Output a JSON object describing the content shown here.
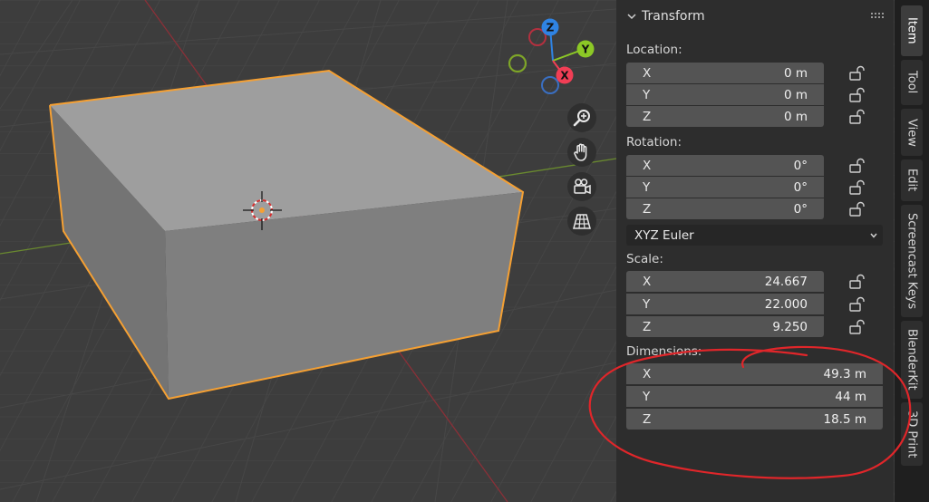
{
  "gizmo": {
    "z_label": "Z",
    "y_label": "Y",
    "x_label": "X",
    "colors": {
      "z": "#2f83e3",
      "y": "#8cc826",
      "x": "#f13e55"
    }
  },
  "nav_icons": [
    "zoom-icon",
    "hand-pan-icon",
    "camera-icon",
    "grid-perspective-icon"
  ],
  "panel": {
    "title": "Transform",
    "location": {
      "label": "Location:",
      "rows": [
        {
          "axis": "X",
          "value": "0 m"
        },
        {
          "axis": "Y",
          "value": "0 m"
        },
        {
          "axis": "Z",
          "value": "0 m"
        }
      ]
    },
    "rotation": {
      "label": "Rotation:",
      "rows": [
        {
          "axis": "X",
          "value": "0°"
        },
        {
          "axis": "Y",
          "value": "0°"
        },
        {
          "axis": "Z",
          "value": "0°"
        }
      ],
      "mode": "XYZ Euler"
    },
    "scale": {
      "label": "Scale:",
      "rows": [
        {
          "axis": "X",
          "value": "24.667"
        },
        {
          "axis": "Y",
          "value": "22.000"
        },
        {
          "axis": "Z",
          "value": "9.250"
        }
      ]
    },
    "dimensions": {
      "label": "Dimensions:",
      "rows": [
        {
          "axis": "X",
          "value": "49.3 m"
        },
        {
          "axis": "Y",
          "value": "44 m"
        },
        {
          "axis": "Z",
          "value": "18.5 m"
        }
      ]
    }
  },
  "tabs": [
    "Item",
    "Tool",
    "View",
    "Edit",
    "Screencast Keys",
    "BlenderKit",
    "3D Print"
  ],
  "colors": {
    "selection_outline": "#f5a033",
    "annotation": "#e0262a"
  }
}
